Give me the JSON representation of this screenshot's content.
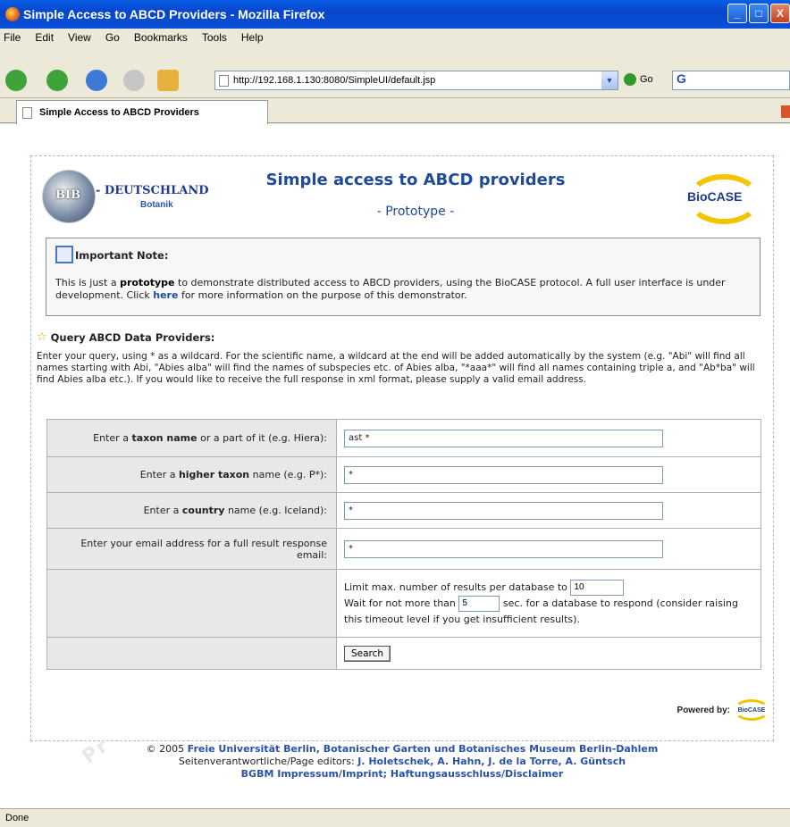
{
  "window": {
    "title": "Simple Access to ABCD Providers - Mozilla Firefox",
    "minimize": "_",
    "maximize": "□",
    "close": "X"
  },
  "menu": [
    "File",
    "Edit",
    "View",
    "Go",
    "Bookmarks",
    "Tools",
    "Help"
  ],
  "toolbar": {
    "url": "http://192.168.1.130:8080/SimpleUI/default.jsp",
    "go_label": "Go",
    "search_logo": "G"
  },
  "tab": {
    "label": "Simple Access to ABCD Providers"
  },
  "header": {
    "logo_left_text": "BIB",
    "logo_left_name": "- DEUTSCHLAND",
    "logo_left_sub": "Botanik",
    "title": "Simple access to ABCD providers",
    "subtitle": "- Prototype -",
    "logo_right_text": "BioCASE"
  },
  "note": {
    "heading": "Important Note:",
    "text1": "This is just a ",
    "bold": "prototype",
    "text2": " to demonstrate distributed access to ABCD providers, using the BioCASE protocol. A full user interface is under development. Click ",
    "link": "here",
    "text3": " for more information on the purpose of this demonstrator."
  },
  "query": {
    "heading": "Query ABCD Data Providers:",
    "instructions": "Enter your query, using * as a wildcard. For the scientific name, a wildcard at the end will be added automatically by the system (e.g. \"Abi\" will find all names starting with Abi, \"Abies alba\" will find the names of subspecies etc. of Abies alba, \"*aaa*\" will find all names containing triple a, and \"Ab*ba\" will find Abies alba etc.). If you would like to receive the full response in xml format, please supply a valid email address."
  },
  "form": {
    "taxon": {
      "pre": "Enter a ",
      "bold": "taxon name",
      "post": " or a part of it (e.g. Hiera):",
      "value": "ast *"
    },
    "higher": {
      "pre": "Enter a ",
      "bold": "higher taxon",
      "post": " name (e.g. P*):",
      "value": "*"
    },
    "country": {
      "pre": "Enter a ",
      "bold": "country",
      "post": " name (e.g. Iceland):",
      "value": "*"
    },
    "email": {
      "label": "Enter your email address for a full result response email:",
      "value": "*"
    },
    "limit": {
      "pre": "Limit max. number of results per database to",
      "value": "10"
    },
    "wait": {
      "pre": "Wait for not more than",
      "value": "5",
      "post": "sec. for a database to respond (consider raising this timeout level if you get insufficient results)."
    },
    "search_label": "Search"
  },
  "powered": {
    "label": "Powered by:",
    "logo": "BioCASE"
  },
  "footer": {
    "line1_pre": "© 2005 ",
    "line1_bold": "Freie Universität Berlin, Botanischer Garten und Botanisches Museum Berlin-Dahlem",
    "line2_pre": "Seitenverantwortliche/Page editors: ",
    "line2_bold": "J. Holetschek, A. Hahn, J. de la Torre, A. Güntsch",
    "line3": "BGBM Impressum/Imprint; Haftungsausschluss/Disclaimer",
    "watermark": "Pr"
  },
  "status": "Done"
}
